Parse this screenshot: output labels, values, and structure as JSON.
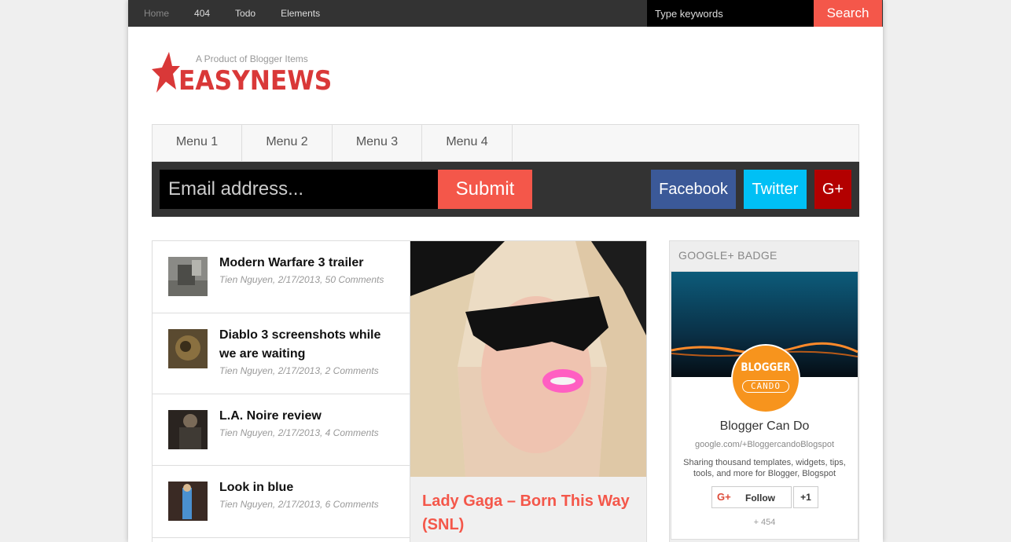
{
  "topnav": {
    "items": [
      {
        "label": "Home"
      },
      {
        "label": "404"
      },
      {
        "label": "Todo"
      },
      {
        "label": "Elements"
      }
    ],
    "search_placeholder": "Type keywords",
    "search_button": "Search"
  },
  "logo": {
    "tagline": "A Product of Blogger Items",
    "wordmark": "EASYNEWS"
  },
  "menu": {
    "items": [
      {
        "label": "Menu 1"
      },
      {
        "label": "Menu 2"
      },
      {
        "label": "Menu 3"
      },
      {
        "label": "Menu 4"
      }
    ]
  },
  "subscribe": {
    "email_placeholder": "Email address...",
    "submit_label": "Submit",
    "facebook": "Facebook",
    "twitter": "Twitter",
    "gplus": "G+"
  },
  "posts": [
    {
      "title": "Modern Warfare 3 trailer",
      "meta": "Tien Nguyen, 2/17/2013, 50 Comments"
    },
    {
      "title": "Diablo 3 screenshots while we are waiting",
      "meta": "Tien Nguyen, 2/17/2013, 2 Comments"
    },
    {
      "title": "L.A. Noire review",
      "meta": "Tien Nguyen, 2/17/2013, 4 Comments"
    },
    {
      "title": "Look in blue",
      "meta": "Tien Nguyen, 2/17/2013, 6 Comments"
    }
  ],
  "featured": {
    "title": "Lady Gaga – Born This Way (SNL)"
  },
  "sidebar": {
    "widget_title": "GOOGLE+ BADGE",
    "avatar_line1": "BLOGGER",
    "avatar_line2": "CANDO",
    "name": "Blogger Can Do",
    "url": "google.com/+BloggercandoBlogspot",
    "description": "Sharing thousand templates, widgets, tips, tools, and more for Blogger, Blogspot",
    "follow_label": "Follow",
    "plus_one": "+1",
    "count": "+ 454"
  },
  "colors": {
    "accent": "#f4574a",
    "logo_red": "#d93838",
    "topbar": "#333333",
    "facebook": "#3b5998",
    "twitter": "#00c0f5",
    "gplus": "#b30000",
    "avatar": "#f7941d"
  },
  "icons": {
    "logo_star": "star-icon",
    "gplus_badge": "google-plus-icon"
  }
}
